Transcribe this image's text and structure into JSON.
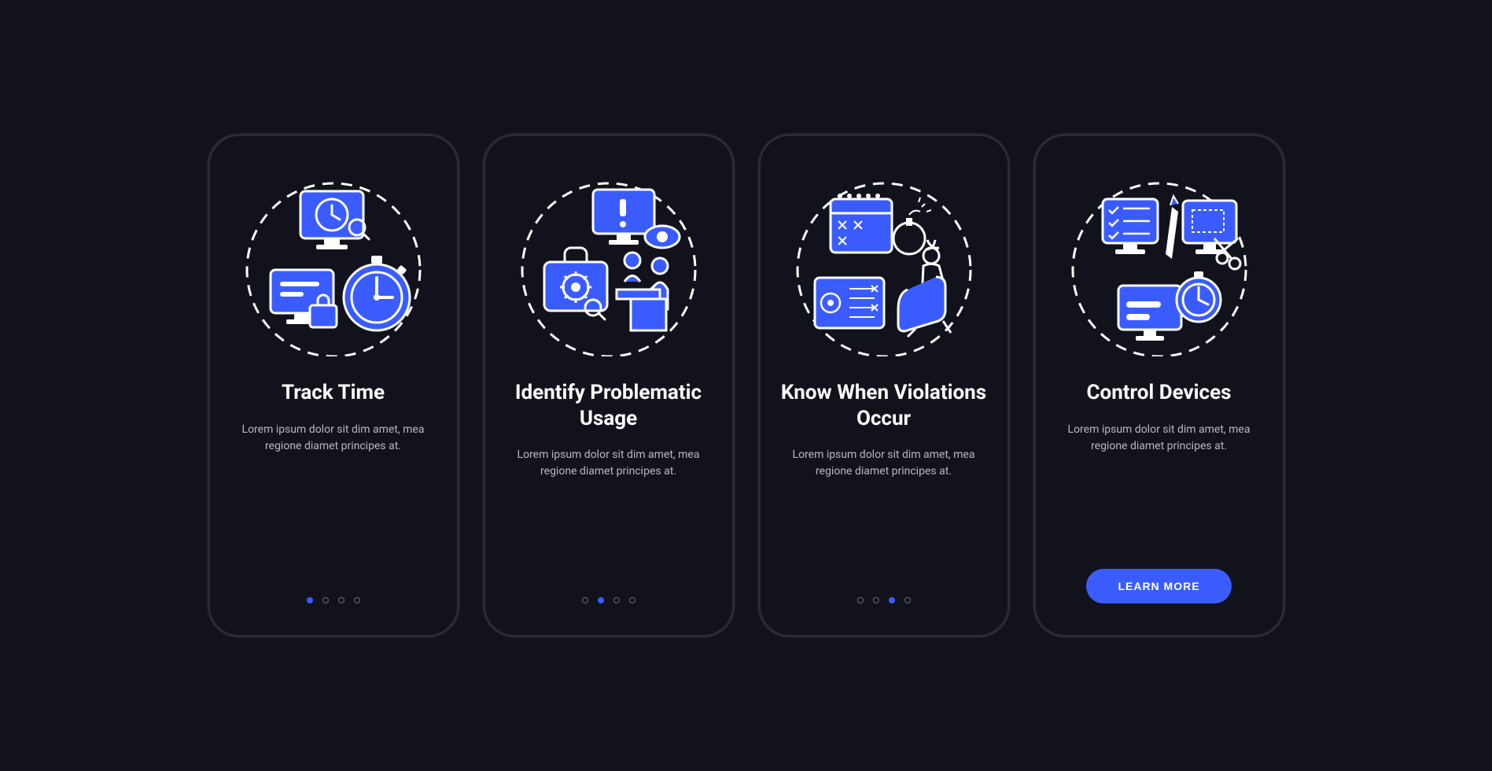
{
  "colors": {
    "accent": "#3a5cff",
    "bg": "#12121c",
    "text": "#ffffff",
    "muted": "#b8b8c4",
    "border": "#2a2a38"
  },
  "screens": [
    {
      "icon": "track-time-icon",
      "title": "Track Time",
      "description": "Lorem ipsum dolor sit dim amet, mea regione diamet principes at.",
      "active_dot": 0,
      "has_cta": false
    },
    {
      "icon": "identify-usage-icon",
      "title": "Identify Problematic Usage",
      "description": "Lorem ipsum dolor sit dim amet, mea regione diamet principes at.",
      "active_dot": 1,
      "has_cta": false
    },
    {
      "icon": "violations-icon",
      "title": "Know When Violations Occur",
      "description": "Lorem ipsum dolor sit dim amet, mea regione diamet principes at.",
      "active_dot": 2,
      "has_cta": false
    },
    {
      "icon": "control-devices-icon",
      "title": "Control Devices",
      "description": "Lorem ipsum dolor sit dim amet, mea regione diamet principes at.",
      "active_dot": 3,
      "has_cta": true,
      "cta_label": "LEARN MORE"
    }
  ],
  "dot_count": 4
}
